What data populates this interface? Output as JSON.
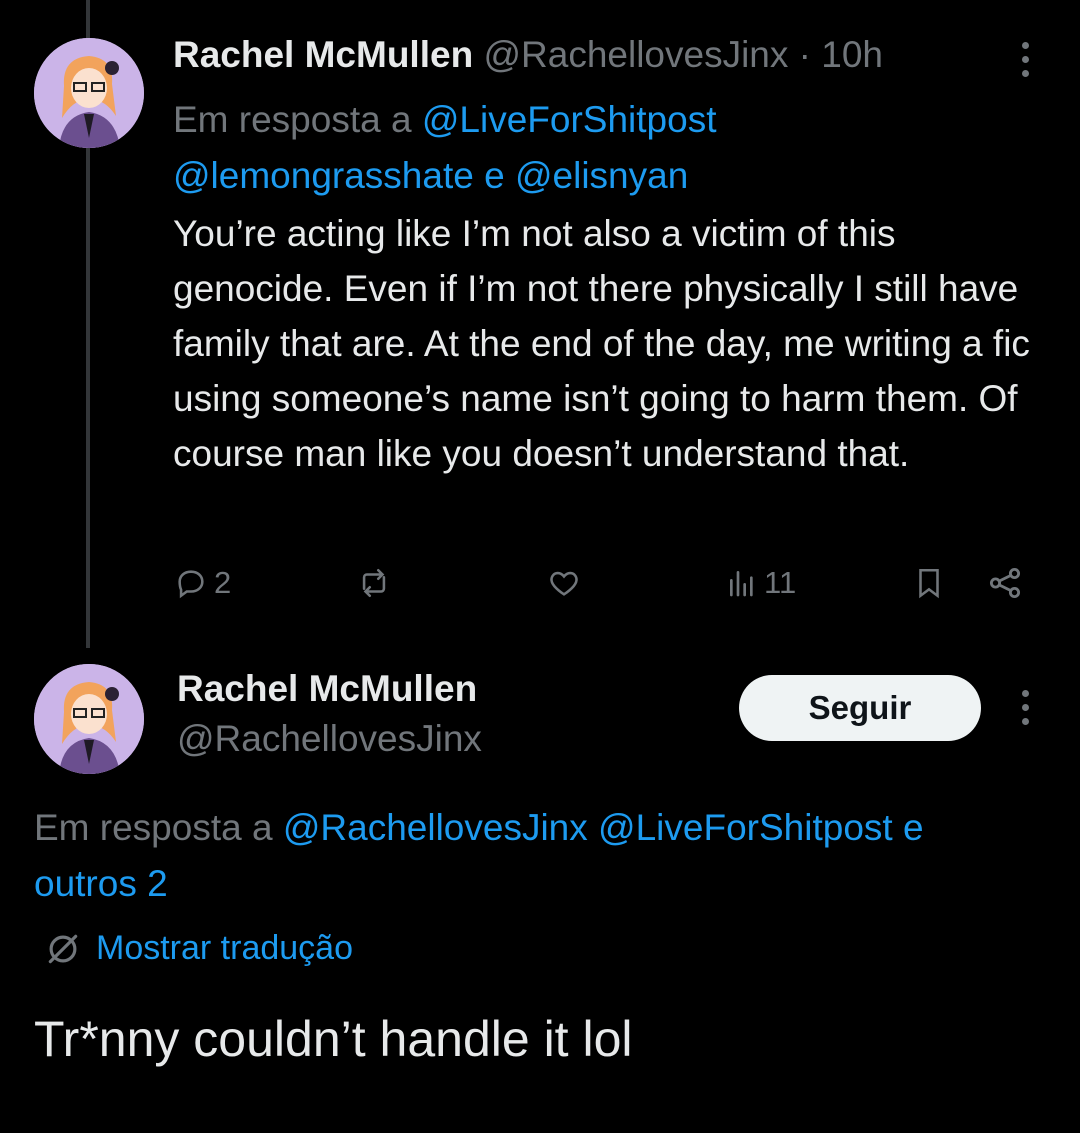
{
  "tweet1": {
    "author_name": "Rachel McMullen",
    "handle": "@RachellovesJinx",
    "separator": "·",
    "time": "10h",
    "reply_prefix": "Em resposta a",
    "reply_mention_1": "@LiveForShitpost",
    "reply_mention_2": "@lemongrasshate",
    "reply_and": "e",
    "reply_mention_3": "@elisnyan",
    "body": "You’re acting like I’m not also a victim of this genocide. Even if I’m not there physically I still have family that are. At the end of the day, me writing a fic using someone’s name isn’t going to harm them. Of course man like you doesn’t understand that.",
    "replies_count": "2",
    "views_count": "11",
    "icons": [
      "reply-icon",
      "retweet-icon",
      "like-icon",
      "views-icon",
      "bookmark-icon",
      "share-icon",
      "more-icon"
    ]
  },
  "tweet2": {
    "author_name": "Rachel McMullen",
    "handle": "@RachellovesJinx",
    "follow_label": "Seguir",
    "reply_prefix": "Em resposta a",
    "reply_mention_1": "@RachellovesJinx",
    "reply_mention_2": "@LiveForShitpost",
    "reply_and": "e",
    "reply_others": "outros 2",
    "translate_label": "Mostrar tradução",
    "body": "Tr*nny couldn’t handle it lol"
  },
  "colors": {
    "background": "#000000",
    "text": "#e7e9ea",
    "muted": "#71767b",
    "link": "#1d9bf0",
    "follow_button_bg": "#eff3f4"
  }
}
